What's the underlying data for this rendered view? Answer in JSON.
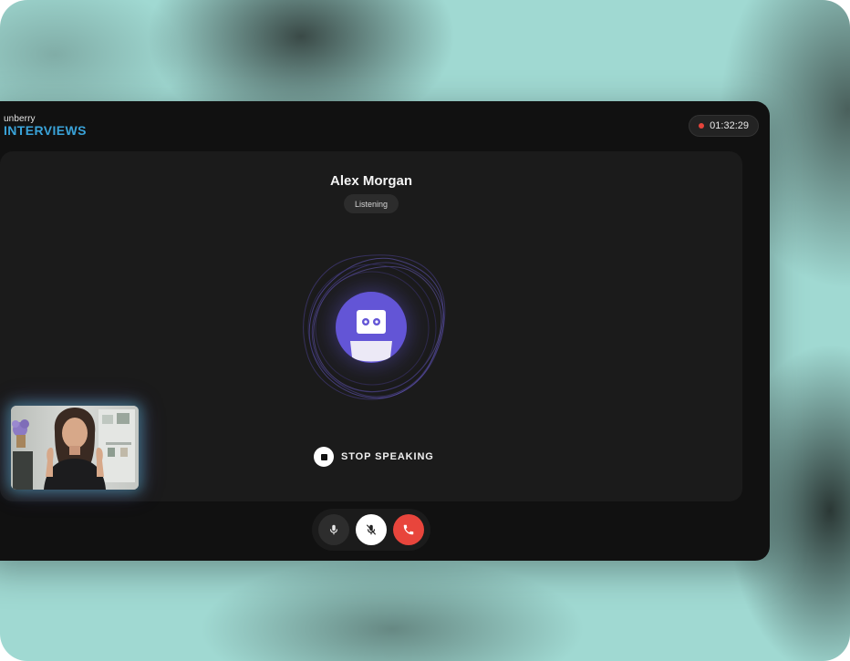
{
  "brand": {
    "small": "unberry",
    "main": "INTERVIEWS"
  },
  "call": {
    "timer": "01:32:29",
    "participant_name": "Alex Morgan",
    "status": "Listening",
    "stop_label": "STOP SPEAKING"
  },
  "colors": {
    "background": "#a0d9d2",
    "app": "#111111",
    "stage": "#1b1b1b",
    "accent_purple": "#6355d6",
    "brand_blue": "#3aa3d9",
    "end_call_red": "#e8453c",
    "recording_dot": "#e5443b"
  },
  "icons": {
    "mic": "microphone-icon",
    "mute": "microphone-off-icon",
    "end": "phone-hangup-icon",
    "stop": "stop-icon",
    "bot": "robot-avatar-icon"
  }
}
